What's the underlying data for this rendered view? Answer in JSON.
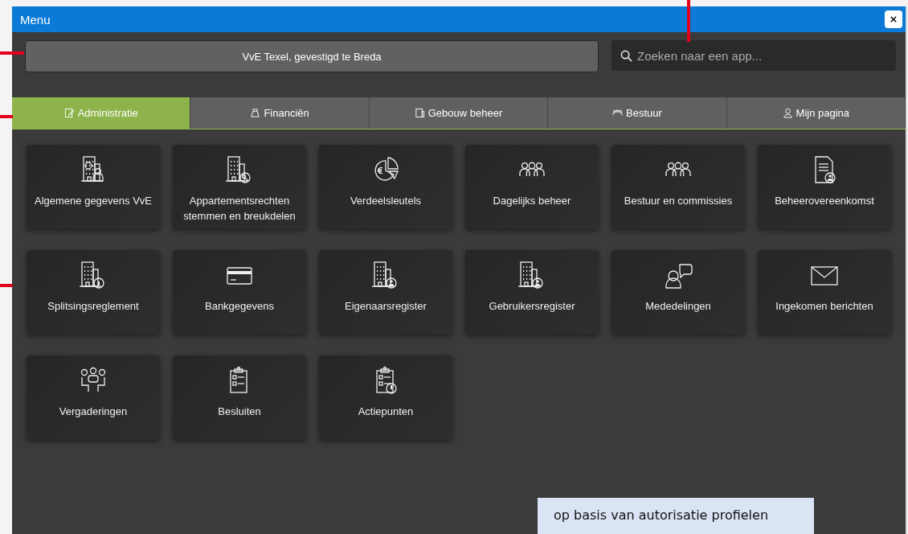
{
  "window": {
    "title": "Menu",
    "close": "×"
  },
  "org_button": {
    "label": "VvE Texel, gevestigd te Breda"
  },
  "search": {
    "placeholder": "Zoeken naar een app..."
  },
  "tabs": [
    {
      "label": "Administratie",
      "selected": true
    },
    {
      "label": "Financiën",
      "selected": false
    },
    {
      "label": "Gebouw beheer",
      "selected": false
    },
    {
      "label": "Bestuur",
      "selected": false
    },
    {
      "label": "Mijn pagina",
      "selected": false
    }
  ],
  "apps": [
    {
      "label": "Algemene gegevens VvE"
    },
    {
      "label": "Appartementsrechten stemmen en breukdelen"
    },
    {
      "label": "Verdeelsleutels"
    },
    {
      "label": "Dagelijks beheer"
    },
    {
      "label": "Bestuur en commissies"
    },
    {
      "label": "Beheerovereenkomst"
    },
    {
      "label": "Splitsingsreglement"
    },
    {
      "label": "Bankgegevens"
    },
    {
      "label": "Eigenaarsregister"
    },
    {
      "label": "Gebruikersregister"
    },
    {
      "label": "Mededelingen"
    },
    {
      "label": "Ingekomen berichten"
    },
    {
      "label": "Vergaderingen"
    },
    {
      "label": "Besluiten"
    },
    {
      "label": "Actiepunten"
    }
  ],
  "callout": {
    "text": "op basis van autorisatie profielen"
  }
}
